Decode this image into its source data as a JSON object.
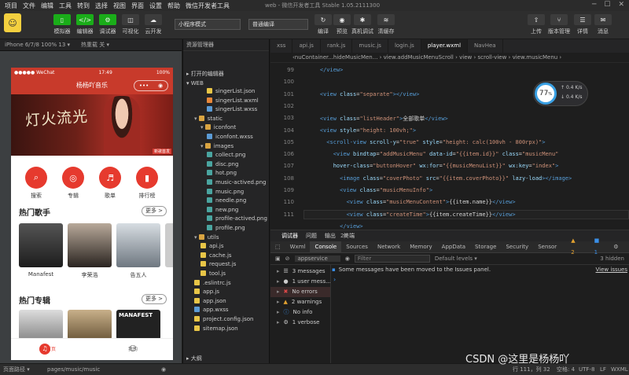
{
  "menu": {
    "items": [
      "项目",
      "文件",
      "编辑",
      "工具",
      "转到",
      "选择",
      "视图",
      "界面",
      "设置",
      "帮助",
      "微信开发者工具"
    ],
    "title": "web - 微信开发者工具 Stable 1.05.2111300"
  },
  "toolbar": {
    "buttons": [
      {
        "label": "模拟器",
        "icon": "phone-icon"
      },
      {
        "label": "编辑器",
        "icon": "code-icon"
      },
      {
        "label": "调试器",
        "icon": "debug-icon"
      },
      {
        "label": "可视化",
        "icon": "visual-icon"
      },
      {
        "label": "云开发",
        "icon": "cloud-icon"
      }
    ],
    "mode_select": "小程序模式",
    "compile_select": "普通编译",
    "actions": [
      {
        "label": "编译",
        "icon": "refresh-icon"
      },
      {
        "label": "预览",
        "icon": "eye-icon"
      },
      {
        "label": "真机调试",
        "icon": "bug-icon"
      },
      {
        "label": "清缓存",
        "icon": "layers-icon"
      }
    ],
    "right": [
      {
        "label": "上传",
        "icon": "upload-icon"
      },
      {
        "label": "版本管理",
        "icon": "branch-icon"
      },
      {
        "label": "详情",
        "icon": "detail-icon"
      },
      {
        "label": "消息",
        "icon": "bell-icon"
      }
    ]
  },
  "simulator": {
    "device": "iPhone 6/7/8 100% 13 ▾",
    "hot_reload": "热重载 关 ▾",
    "status_left": "●●●●● WeChat",
    "status_time": "17:49",
    "status_right": "100%",
    "nav_title": "杨杨吖音乐",
    "banner_text": "灯火流光",
    "banner_badge": "新歌首发",
    "categories": [
      {
        "label": "搜索",
        "icon": "search-icon"
      },
      {
        "label": "专辑",
        "icon": "disc-icon"
      },
      {
        "label": "歌单",
        "icon": "playlist-icon"
      },
      {
        "label": "排行榜",
        "icon": "chart-icon"
      }
    ],
    "singers_title": "热门歌手",
    "more": "更多 >",
    "singers": [
      "Manafest",
      "李荣浩",
      "告五人"
    ],
    "albums_title": "热门专辑",
    "album_text": "MANAFEST",
    "tabbar": [
      {
        "label": "首页",
        "icon": "music-icon"
      },
      {
        "label": "我的",
        "icon": "user-icon"
      }
    ]
  },
  "explorer": {
    "title": "资源管理器",
    "open_editors": "打开的编辑器",
    "root": "WEB",
    "outline": "大纲",
    "files": [
      {
        "name": "singerList.json",
        "type": "json",
        "depth": 3
      },
      {
        "name": "singerList.wxml",
        "type": "wxml",
        "depth": 3
      },
      {
        "name": "singerList.wxss",
        "type": "wxss",
        "depth": 3
      },
      {
        "name": "static",
        "type": "folder",
        "depth": 1
      },
      {
        "name": "iconfont",
        "type": "folder",
        "depth": 2
      },
      {
        "name": "iconfont.wxss",
        "type": "wxss",
        "depth": 3
      },
      {
        "name": "images",
        "type": "folder",
        "depth": 2
      },
      {
        "name": "collect.png",
        "type": "png",
        "depth": 3
      },
      {
        "name": "disc.png",
        "type": "png",
        "depth": 3
      },
      {
        "name": "hot.png",
        "type": "png",
        "depth": 3
      },
      {
        "name": "music-actived.png",
        "type": "png",
        "depth": 3
      },
      {
        "name": "music.png",
        "type": "png",
        "depth": 3
      },
      {
        "name": "needle.png",
        "type": "png",
        "depth": 3
      },
      {
        "name": "new.png",
        "type": "png",
        "depth": 3
      },
      {
        "name": "profile-actived.png",
        "type": "png",
        "depth": 3
      },
      {
        "name": "profile.png",
        "type": "png",
        "depth": 3
      },
      {
        "name": "utils",
        "type": "folder",
        "depth": 1
      },
      {
        "name": "api.js",
        "type": "js",
        "depth": 2
      },
      {
        "name": "cache.js",
        "type": "js",
        "depth": 2
      },
      {
        "name": "request.js",
        "type": "js",
        "depth": 2
      },
      {
        "name": "tool.js",
        "type": "js",
        "depth": 2
      },
      {
        "name": ".eslintrc.js",
        "type": "js",
        "depth": 1
      },
      {
        "name": "app.js",
        "type": "js",
        "depth": 1
      },
      {
        "name": "app.json",
        "type": "json",
        "depth": 1
      },
      {
        "name": "app.wxss",
        "type": "wxss",
        "depth": 1
      },
      {
        "name": "project.config.json",
        "type": "json",
        "depth": 1
      },
      {
        "name": "sitemap.json",
        "type": "json",
        "depth": 1
      }
    ]
  },
  "editor": {
    "tabs": [
      "xss",
      "api.js",
      "rank.js",
      "music.js",
      "login.js",
      "player.wxml",
      "NavHea"
    ],
    "active_tab": "player.wxml",
    "breadcrumb": "‹nuContainer...hideMusicMen... › view.addMusicMenuScroll › view › scroll-view › view.musicMenu ›",
    "lines": [
      {
        "n": "99",
        "code": [
          [
            "tg",
            "    </view>"
          ]
        ]
      },
      {
        "n": "100",
        "code": []
      },
      {
        "n": "101",
        "code": [
          [
            "tg",
            "    <view "
          ],
          [
            "at",
            "class"
          ],
          [
            "tx",
            "="
          ],
          [
            "st",
            "\"separate\""
          ],
          [
            "tg",
            "></view>"
          ]
        ]
      },
      {
        "n": "102",
        "code": []
      },
      {
        "n": "103",
        "code": [
          [
            "tg",
            "    <view "
          ],
          [
            "at",
            "class"
          ],
          [
            "tx",
            "="
          ],
          [
            "st",
            "\"listHeader\""
          ],
          [
            "tg",
            ">"
          ],
          [
            "tx",
            "全部歌单"
          ],
          [
            "tg",
            "</view>"
          ]
        ]
      },
      {
        "n": "104",
        "code": [
          [
            "tg",
            "    <view "
          ],
          [
            "at",
            "style"
          ],
          [
            "tx",
            "="
          ],
          [
            "st",
            "\"height: 100vh;\""
          ],
          [
            "tg",
            ">"
          ]
        ]
      },
      {
        "n": "105",
        "code": [
          [
            "tg",
            "      <scroll-view "
          ],
          [
            "at",
            "scroll-y"
          ],
          [
            "tx",
            "="
          ],
          [
            "st",
            "\"true\" "
          ],
          [
            "at",
            "style"
          ],
          [
            "tx",
            "="
          ],
          [
            "st",
            "\"height: calc(100vh - 800rpx)\""
          ],
          [
            "tg",
            ">"
          ]
        ]
      },
      {
        "n": "106",
        "code": [
          [
            "tg",
            "        <view "
          ],
          [
            "at",
            "bindtap"
          ],
          [
            "tx",
            "="
          ],
          [
            "st",
            "\"addMusicMenu\" "
          ],
          [
            "at",
            "data-id"
          ],
          [
            "tx",
            "="
          ],
          [
            "st",
            "\"{{item.id}}\" "
          ],
          [
            "at",
            "class"
          ],
          [
            "tx",
            "="
          ],
          [
            "st",
            "\"musicMenu\""
          ]
        ]
      },
      {
        "n": "107",
        "code": [
          [
            "at",
            "        hover-class"
          ],
          [
            "tx",
            "="
          ],
          [
            "st",
            "\"buttonHover\" "
          ],
          [
            "at",
            "wx:for"
          ],
          [
            "tx",
            "="
          ],
          [
            "st",
            "\"{{musicMenuList}}\" "
          ],
          [
            "at",
            "wx:key"
          ],
          [
            "tx",
            "="
          ],
          [
            "st",
            "\"index\""
          ],
          [
            "tg",
            ">"
          ]
        ]
      },
      {
        "n": "108",
        "code": [
          [
            "tg",
            "          <image "
          ],
          [
            "at",
            "class"
          ],
          [
            "tx",
            "="
          ],
          [
            "st",
            "\"coverPhoto\" "
          ],
          [
            "at",
            "src"
          ],
          [
            "tx",
            "="
          ],
          [
            "st",
            "\"{{item.coverPhoto}}\" "
          ],
          [
            "at",
            "lazy-load"
          ],
          [
            "tg",
            "></image>"
          ]
        ]
      },
      {
        "n": "109",
        "code": [
          [
            "tg",
            "          <view "
          ],
          [
            "at",
            "class"
          ],
          [
            "tx",
            "="
          ],
          [
            "st",
            "\"musicMenuInfo\""
          ],
          [
            "tg",
            ">"
          ]
        ]
      },
      {
        "n": "110",
        "code": [
          [
            "tg",
            "            <view "
          ],
          [
            "at",
            "class"
          ],
          [
            "tx",
            "="
          ],
          [
            "st",
            "\"musicMenuContent\""
          ],
          [
            "tg",
            ">"
          ],
          [
            "tx",
            "{{item.name}}"
          ],
          [
            "tg",
            "</view>"
          ]
        ]
      },
      {
        "n": "111",
        "code": [
          [
            "tg",
            "            <view "
          ],
          [
            "at",
            "class"
          ],
          [
            "tx",
            "="
          ],
          [
            "st",
            "\"createTime\""
          ],
          [
            "tg",
            ">"
          ],
          [
            "tx",
            "{{item.createTime}}"
          ],
          [
            "tg",
            "</view>"
          ]
        ]
      },
      {
        "n": "",
        "code": [
          [
            "tg",
            "          </view>"
          ]
        ]
      },
      {
        "n": "",
        "code": [
          [
            "tg",
            "        </view>"
          ]
        ]
      }
    ],
    "gauge_value": "77",
    "gauge_unit": "%",
    "net_up": "0.4",
    "net_down": "0.4",
    "net_unit": "K/s"
  },
  "devtools": {
    "top_tabs": [
      "调试器",
      "问题",
      "输出",
      "终端"
    ],
    "top_badge": "23",
    "tabs": [
      "Wxml",
      "Console",
      "Sources",
      "Network",
      "Memory",
      "AppData",
      "Storage",
      "Security",
      "Sensor"
    ],
    "active_tab": "Console",
    "warn_count": "2",
    "err_count": "1",
    "context": "appservice",
    "filter_placeholder": "Filter",
    "levels": "Default levels ▾",
    "hidden": "3 hidden",
    "notice": "Some messages have been moved to the Issues panel.",
    "view_issues": "View issues",
    "groups": [
      {
        "label": "3 messages",
        "icon": "list-icon",
        "color": "#ccc"
      },
      {
        "label": "1 user mess...",
        "icon": "user-icon",
        "color": "#ccc"
      },
      {
        "label": "No errors",
        "icon": "error-icon",
        "color": "#e04848"
      },
      {
        "label": "2 warnings",
        "icon": "warning-icon",
        "color": "#e0a030"
      },
      {
        "label": "No info",
        "icon": "info-icon",
        "color": "#3a8ee6"
      },
      {
        "label": "1 verbose",
        "icon": "gear-icon",
        "color": "#ccc"
      }
    ]
  },
  "statusbar": {
    "path_label": "页面路径 ▾",
    "path": "pages/music/music",
    "position": "行 111，列 32",
    "spaces": "空格: 4",
    "encoding": "UTF-8",
    "eol": "LF",
    "lang": "WXML"
  },
  "watermark": "CSDN @这里是杨杨吖"
}
